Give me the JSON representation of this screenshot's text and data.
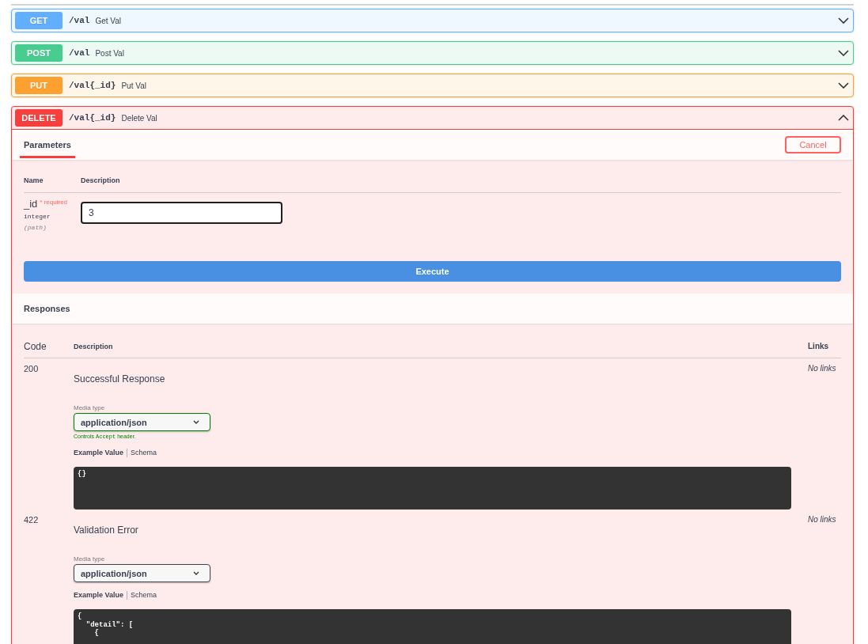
{
  "operations": [
    {
      "method": "GET",
      "color": "#61affe",
      "path": "/val",
      "summary": "Get Val",
      "expanded": false
    },
    {
      "method": "POST",
      "color": "#49cc90",
      "path": "/val",
      "summary": "Post Val",
      "expanded": false
    },
    {
      "method": "PUT",
      "color": "#fca130",
      "path": "/val{_id}",
      "summary": "Put Val",
      "expanded": false
    },
    {
      "method": "DELETE",
      "color": "#f93e3e",
      "path": "/val{_id}",
      "summary": "Delete Val",
      "expanded": true,
      "tabs": [
        {
          "label": "Parameters",
          "selected": true
        }
      ],
      "cancel_button": "Cancel",
      "parameters": {
        "columns": [
          "Name",
          "Description"
        ],
        "rows": [
          {
            "name": "_id",
            "required_note": "* required",
            "type": "integer",
            "location": "(path)",
            "value": "3"
          }
        ]
      },
      "execute_button": "Execute",
      "responses": {
        "title": "Responses",
        "columns": [
          "Code",
          "Description",
          "Links"
        ],
        "rows": [
          {
            "code": "200",
            "description": "Successful Response",
            "links": "No links",
            "media_type_label": "Media type",
            "media_type": "application/json",
            "controls_accept": true,
            "media_hint": {
              "before": "Controls",
              "code": "Accept",
              "after": "header."
            },
            "example_tabs": [
              {
                "label": "Example Value",
                "selected": true
              },
              {
                "label": "Schema",
                "selected": false
              }
            ],
            "example": "{}"
          },
          {
            "code": "422",
            "description": "Validation Error",
            "links": "No links",
            "media_type_label": "Media type",
            "media_type": "application/json",
            "controls_accept": false,
            "example_tabs": [
              {
                "label": "Example Value",
                "selected": true
              },
              {
                "label": "Schema",
                "selected": false
              }
            ],
            "example": "{\n  \"detail\": [\n    {"
          }
        ]
      }
    }
  ]
}
